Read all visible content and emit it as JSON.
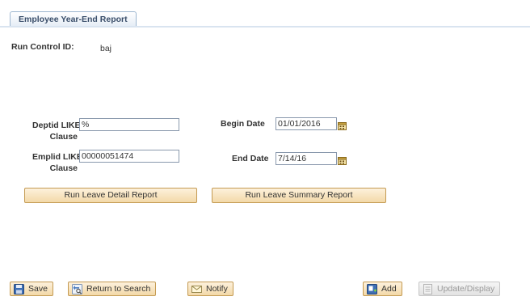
{
  "page": {
    "tab_label": "Employee Year-End Report"
  },
  "run_control": {
    "label": "Run Control ID:",
    "value": "baj"
  },
  "fields": {
    "deptid_label_line1": "Deptid LIKE",
    "deptid_label_line2": "Clause",
    "deptid_value": "%",
    "emplid_label_line1": "Emplid LIKE",
    "emplid_label_line2": "Clause",
    "emplid_value": "00000051474",
    "begin_date_label": "Begin Date",
    "begin_date_value": "01/01/2016",
    "end_date_label": "End Date",
    "end_date_value": "7/14/16"
  },
  "actions": {
    "detail_report_label": "Run Leave Detail Report",
    "summary_report_label": "Run Leave Summary Report"
  },
  "toolbar": {
    "save_label": "Save",
    "return_label": "Return to Search",
    "notify_label": "Notify",
    "add_label": "Add",
    "update_label": "Update/Display"
  },
  "colors": {
    "button_fill": "#f3d9a8",
    "button_border": "#c49a52",
    "tab_text": "#3a4e6a",
    "field_border": "#8a99ad"
  }
}
